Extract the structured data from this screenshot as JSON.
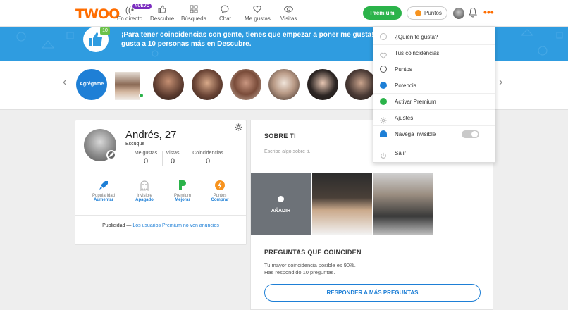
{
  "brand": {
    "logo": "TWOO",
    "accent": "#ff6d00"
  },
  "nav": {
    "live": {
      "label": "En directo",
      "badge": "NUEVO",
      "icon": "broadcast-icon"
    },
    "discover": {
      "label": "Descubre",
      "icon": "thumb-icon"
    },
    "search": {
      "label": "Búsqueda",
      "icon": "grid-icon"
    },
    "chat": {
      "label": "Chat",
      "icon": "chat-icon"
    },
    "likes": {
      "label": "Me gustas",
      "icon": "heart-icon"
    },
    "visits": {
      "label": "Visitas",
      "icon": "eye-icon"
    }
  },
  "header": {
    "premium_label": "Premium",
    "points_label": "Puntos"
  },
  "banner": {
    "line1": "¡Para tener coincidencias con gente, tienes que empezar a poner me gusta! Int",
    "line2": "gusta a 10 personas más en Descubre.",
    "badge": "10"
  },
  "carousel": {
    "add_label": "Agrégame"
  },
  "profile": {
    "name": "Andrés, 27",
    "location": "Escuque",
    "stats": [
      {
        "label": "Me gustas",
        "value": "0"
      },
      {
        "label": "Vistas",
        "value": "0"
      },
      {
        "label": "Coincidencias",
        "value": "0"
      }
    ],
    "features": [
      {
        "label": "Popularidad",
        "action": "Aumentar",
        "icon": "rocket-icon",
        "color": "#1e7fd6"
      },
      {
        "label": "Invisible",
        "action": "Apagado",
        "icon": "ghost-icon",
        "color": "#bbbbbb"
      },
      {
        "label": "Premium",
        "action": "Mejorar",
        "icon": "premium-p-icon",
        "color": "#2bb34a"
      },
      {
        "label": "Puntos",
        "action": "Comprar",
        "icon": "bolt-icon",
        "color": "#f7931e"
      }
    ],
    "ad_prefix": "Publicidad —",
    "ad_link": "Los usuarios Premium no ven anuncios"
  },
  "about": {
    "title": "SOBRE TI",
    "placeholder": "Escribe algo sobre ti.",
    "add_photo": "AÑADIR"
  },
  "questions": {
    "title": "PREGUNTAS QUE COINCIDEN",
    "line1": "Tu mayor coincidencia posible es 90%.",
    "line2": "Has respondido 10 preguntas.",
    "button": "RESPONDER A MÁS PREGUNTAS"
  },
  "menu": {
    "items": [
      {
        "label": "¿Quién te gusta?",
        "icon": "check-circle-icon",
        "color": "#bbbbbb"
      },
      {
        "label": "Tus coincidencias",
        "icon": "heart-icon",
        "color": "#bbbbbb"
      },
      {
        "label": "Puntos",
        "icon": "bolt-icon",
        "color": "#555555"
      },
      {
        "label": "Potencia",
        "icon": "rocket-icon",
        "color": "#1e7fd6"
      },
      {
        "label": "Activar Premium",
        "icon": "premium-p-icon",
        "color": "#2bb34a"
      },
      {
        "label": "Ajustes",
        "icon": "gear-icon",
        "color": "#bbbbbb"
      },
      {
        "label": "Navega invisible",
        "icon": "ghost-icon",
        "color": "#1e7fd6"
      },
      {
        "label": "Salir",
        "icon": "power-icon",
        "color": "#bbbbbb"
      }
    ]
  }
}
